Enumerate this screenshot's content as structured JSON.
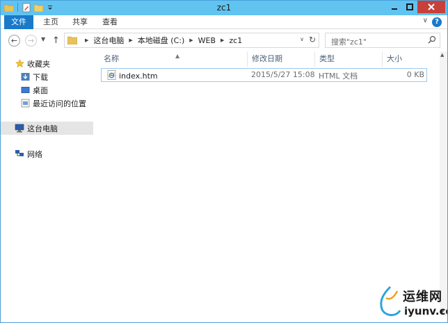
{
  "window": {
    "title": "zc1",
    "accent_color": "#61c3f0",
    "close_color": "#c7413a"
  },
  "ribbon": {
    "tabs": [
      {
        "label": "文件"
      },
      {
        "label": "主页"
      },
      {
        "label": "共享"
      },
      {
        "label": "查看"
      }
    ],
    "file_tab_color": "#1979ca",
    "help_label": "?"
  },
  "navigation": {
    "breadcrumbs": [
      "这台电脑",
      "本地磁盘 (C:)",
      "WEB",
      "zc1"
    ],
    "search_placeholder": "搜索\"zc1\""
  },
  "sidebar": {
    "favorites": {
      "label": "收藏夹",
      "items": [
        {
          "label": "下载"
        },
        {
          "label": "桌面"
        },
        {
          "label": "最近访问的位置"
        }
      ]
    },
    "this_pc": {
      "label": "这台电脑"
    },
    "network": {
      "label": "网络"
    }
  },
  "file_list": {
    "columns": [
      {
        "label": "名称"
      },
      {
        "label": "修改日期"
      },
      {
        "label": "类型"
      },
      {
        "label": "大小"
      }
    ],
    "rows": [
      {
        "name": "index.htm",
        "modified": "2015/5/27 15:08",
        "type": "HTML 文档",
        "size": "0 KB",
        "icon": "ie-html-file-icon"
      }
    ]
  },
  "watermark": {
    "cn": "运维网",
    "en": "iyunv.com"
  }
}
